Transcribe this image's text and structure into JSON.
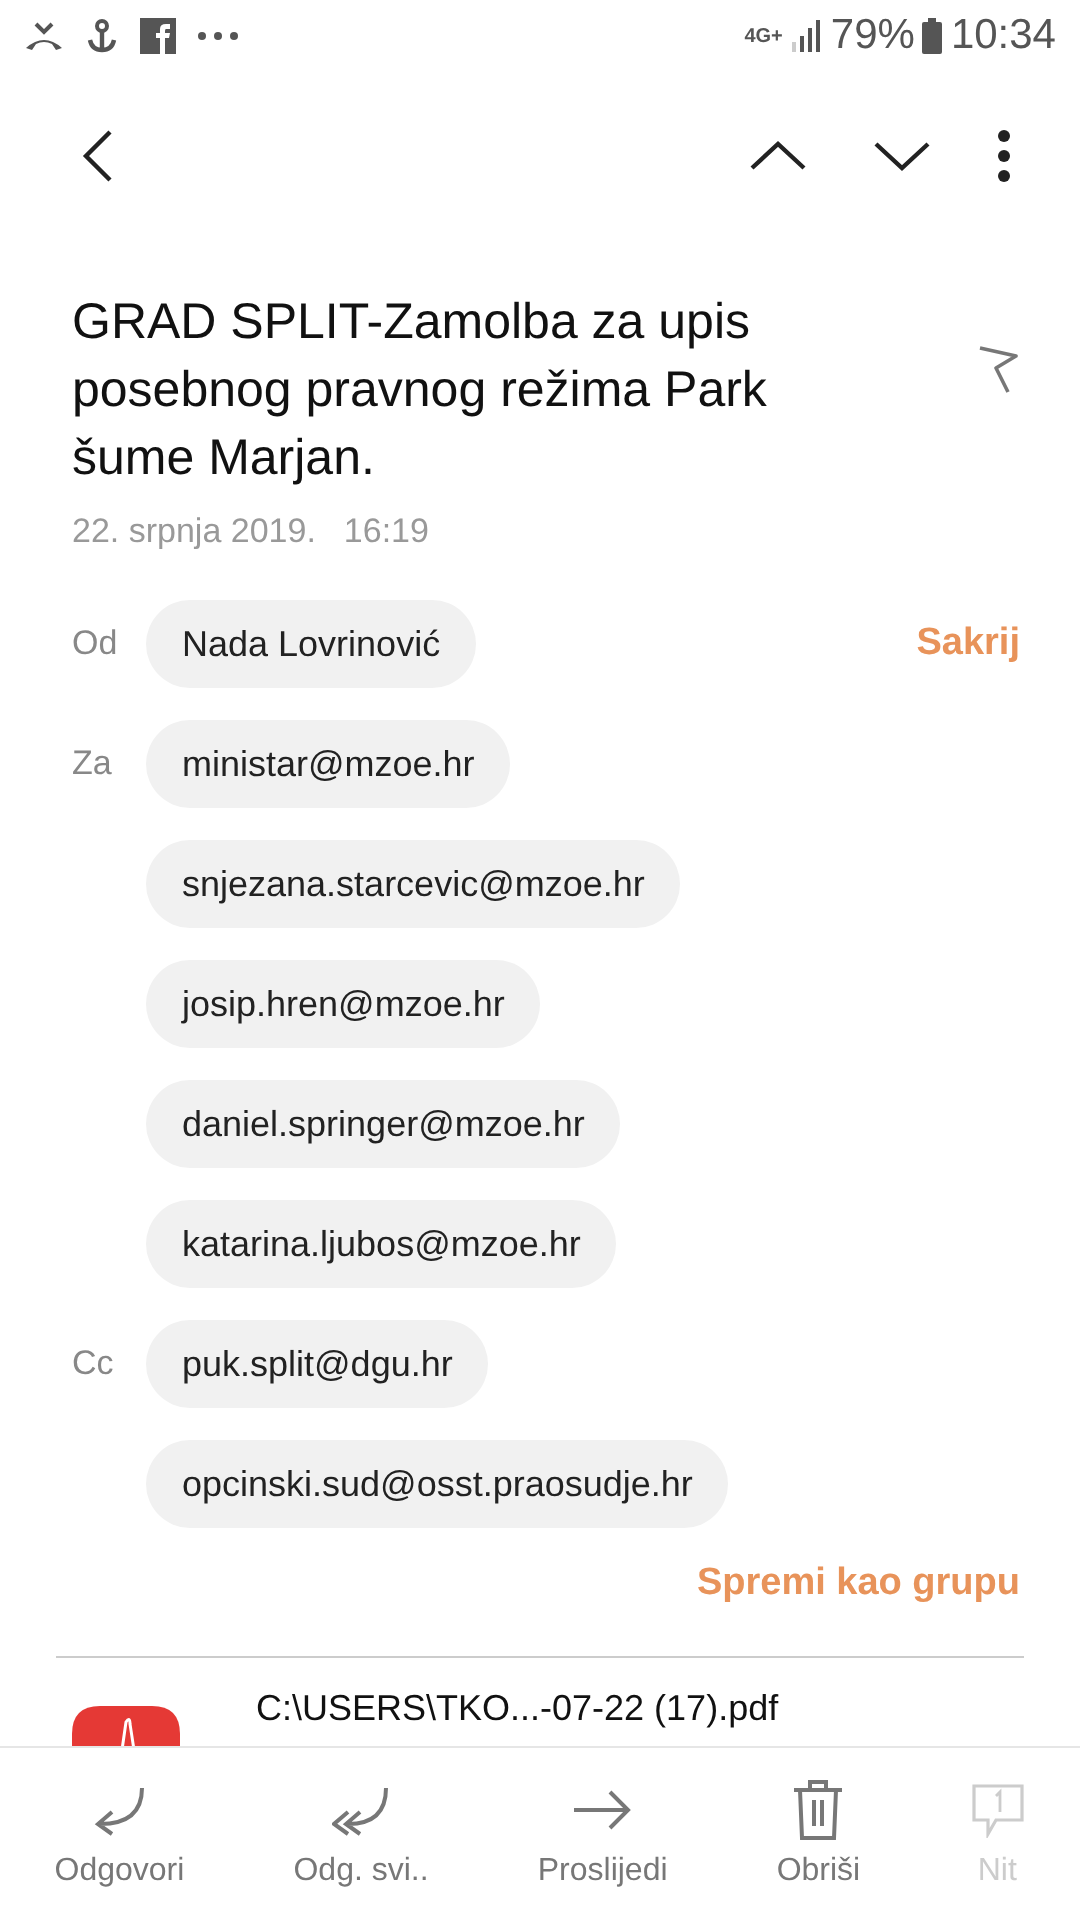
{
  "status_bar": {
    "network": "4G+",
    "battery": "79%",
    "time": "10:34"
  },
  "subject": "GRAD SPLIT-Zamolba za upis posebnog pravnog režima Park šume Marjan.",
  "date": "22. srpnja 2019.",
  "time": "16:19",
  "hide_link": "Sakrij",
  "recipient_groups": [
    {
      "label": "Od",
      "addresses": [
        "Nada Lovrinović"
      ]
    },
    {
      "label": "Za",
      "addresses": [
        "ministar@mzoe.hr",
        "snjezana.starcevic@mzoe.hr",
        "josip.hren@mzoe.hr",
        "daniel.springer@mzoe.hr",
        "katarina.ljubos@mzoe.hr"
      ]
    },
    {
      "label": "Cc",
      "addresses": [
        "puk.split@dgu.hr",
        "opcinski.sud@osst.praosudje.hr"
      ]
    }
  ],
  "save_group_link": "Spremi kao grupu",
  "attachment": {
    "name": "C:\\USERS\\TKO...-07-22 (17).pdf"
  },
  "actions": [
    {
      "kind": "reply",
      "label": "Odgovori",
      "disabled": false
    },
    {
      "kind": "reply_all",
      "label": "Odg. svi..",
      "disabled": false
    },
    {
      "kind": "forward",
      "label": "Proslijedi",
      "disabled": false
    },
    {
      "kind": "delete",
      "label": "Obriši",
      "disabled": false
    },
    {
      "kind": "thread",
      "label": "Nit",
      "disabled": true
    }
  ]
}
